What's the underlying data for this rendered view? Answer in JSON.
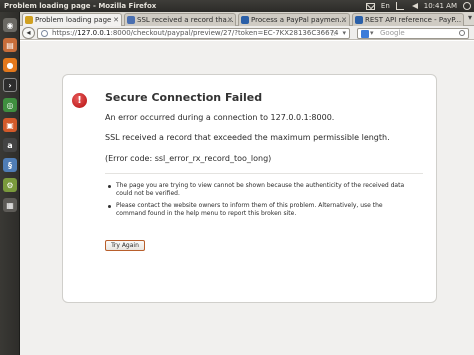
{
  "panel": {
    "window_title": "Problem loading page - Mozilla Firefox",
    "keyboard_layout": "En",
    "clock": "10:41 AM"
  },
  "launcher": {
    "icons": [
      "dash-icon",
      "files-icon",
      "firefox-icon",
      "terminal-icon",
      "chrome-icon",
      "software-center-icon",
      "amazon-icon",
      "python-icon",
      "system-settings-icon",
      "workspace-switcher-icon"
    ]
  },
  "tabs": [
    {
      "label": "Problem loading page",
      "active": true
    },
    {
      "label": "SSL received a record tha...",
      "active": false
    },
    {
      "label": "Process a PayPal paymen...",
      "active": false
    },
    {
      "label": "REST API reference - PayP...",
      "active": false
    }
  ],
  "navbar": {
    "url_prefix": "https://",
    "url_host": "127.0.0.1",
    "url_rest": ":8000/checkout/paypal/preview/27/?token=EC-7KX28136C36674",
    "search_placeholder": "Google"
  },
  "error": {
    "title": "Secure Connection Failed",
    "line1": "An error occurred during a connection to 127.0.0.1:8000.",
    "line2": "SSL received a record that exceeded the maximum permissible length.",
    "line3": "(Error code: ssl_error_rx_record_too_long)",
    "bullets": [
      "The page you are trying to view cannot be shown because the authenticity of the received data could not be verified.",
      "Please contact the website owners to inform them of this problem. Alternatively, use the command found in the help menu to report this broken site."
    ],
    "button_label": "Try Again"
  },
  "colors": {
    "error_icon": "#c41313",
    "button_border": "#b85f2c",
    "panel_bg": "#3a3935"
  }
}
